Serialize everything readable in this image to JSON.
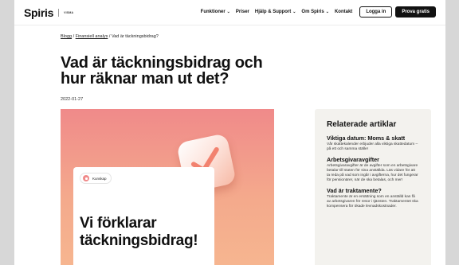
{
  "nav": {
    "logo": "Spiris",
    "logo_sub": "VISMA",
    "items": [
      {
        "label": "Funktioner",
        "has_menu": true
      },
      {
        "label": "Priser",
        "has_menu": false
      },
      {
        "label": "Hjälp & Support",
        "has_menu": true
      },
      {
        "label": "Om Spiris",
        "has_menu": true
      },
      {
        "label": "Kontakt",
        "has_menu": false
      }
    ],
    "login": "Logga in",
    "try_free": "Prova gratis"
  },
  "breadcrumb": {
    "items": [
      "Blogg",
      "Finansiell analys"
    ],
    "separator": "/",
    "current": "Vad är täckningsbidrag?"
  },
  "article": {
    "title_line1": "Vad är täckningsbidrag och",
    "title_line2": "hur räknar man ut det?",
    "date": "2022-01-27"
  },
  "hero": {
    "tag": "Kunskap",
    "headline_line1": "Vi förklarar",
    "headline_line2": "täckningsbidrag!",
    "icon": "check-tile-icon",
    "colors": {
      "gradient_top": "#f08a8a",
      "gradient_bottom": "#f6b690",
      "check": "#f2826f"
    }
  },
  "related": {
    "heading": "Relaterade artiklar",
    "articles": [
      {
        "title": "Viktiga datum: Moms & skatt",
        "text": "Vår skattekalender erbjuder alla viktiga skattedatum – på ett och samma ställe!"
      },
      {
        "title": "Arbetsgivaravgifter",
        "text": "Arbetsgivaravgifter är de avgifter som en arbetsgivare betalar till staten för sina anställda. Läs vidare för att ta reda på vad som ingår i avgifterna, hur det fungerar för pensionärer, när de ska betalas, och mer!"
      },
      {
        "title": "Vad är traktamente?",
        "text": "Traktamente är en ersättning som en anställd kan få av arbetsgivaren för resor i tjänsten. Traktamentet ska kompensera för ökade levnadskostnader."
      }
    ]
  }
}
